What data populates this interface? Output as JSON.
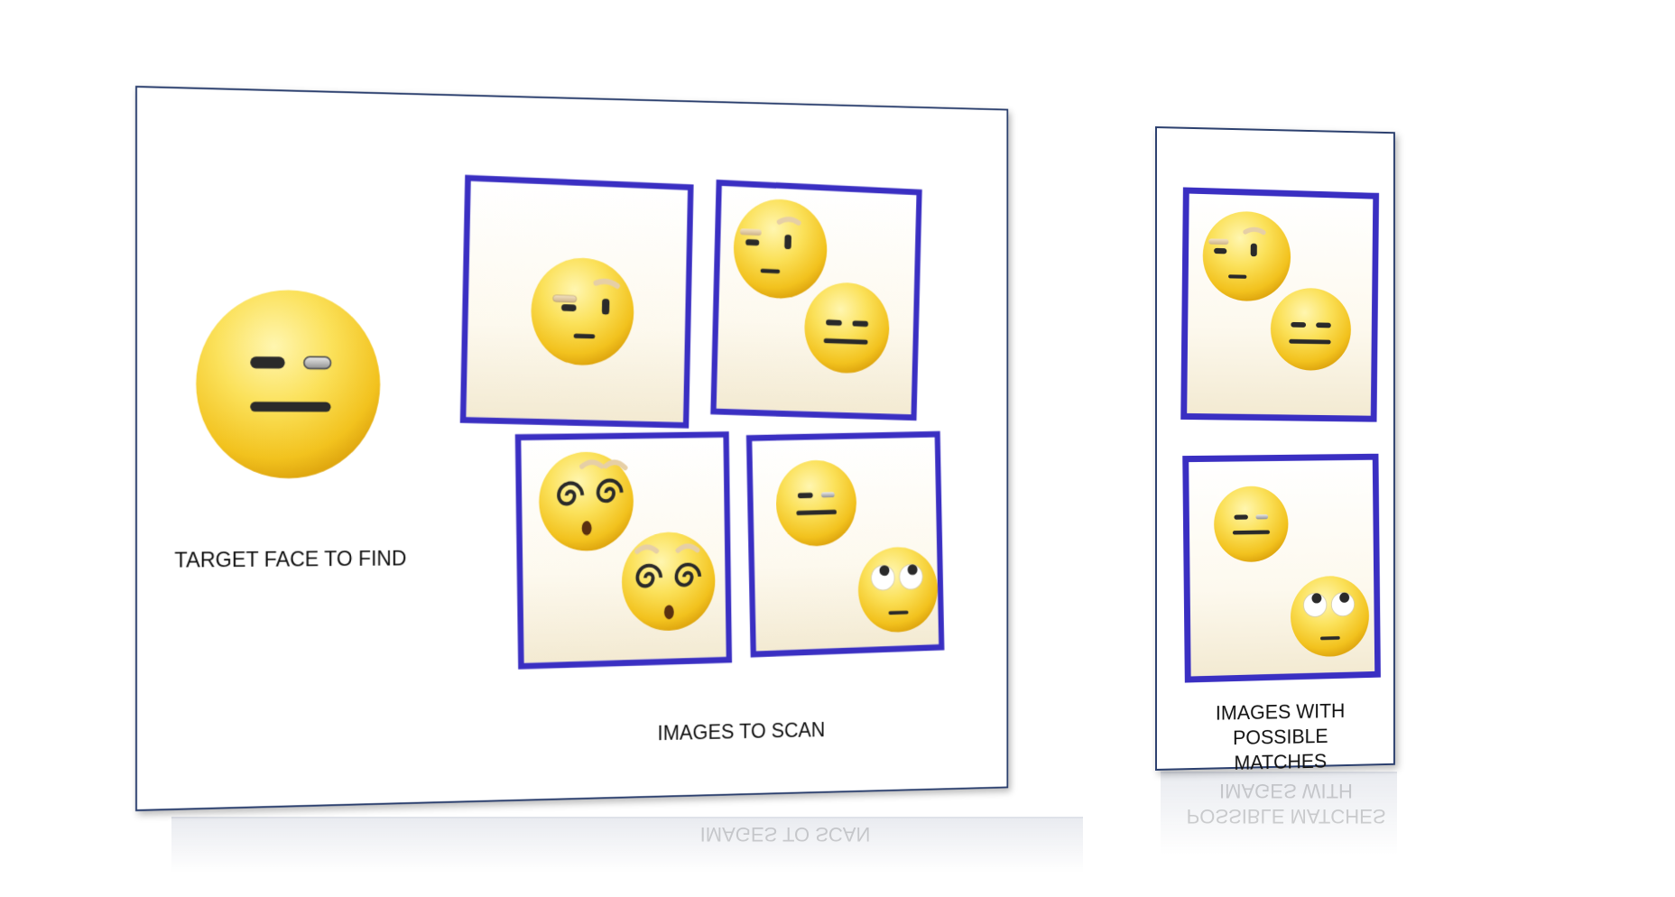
{
  "labels": {
    "target": "TARGET FACE TO FIND",
    "scan": "IMAGES TO SCAN",
    "matches_line1": "IMAGES WITH",
    "matches_line2": "POSSIBLE MATCHES"
  },
  "icons": {
    "target": "neutral-wink-face-icon",
    "raised_eyebrow": "raised-eyebrow-face-icon",
    "expressionless": "expressionless-face-icon",
    "dizzy": "dizzy-face-icon",
    "eye_roll": "eye-roll-face-icon"
  },
  "colors": {
    "frame_border": "#3a2fc2",
    "panel_border": "#2b3f6e",
    "face_yellow": "#f7d33a"
  }
}
